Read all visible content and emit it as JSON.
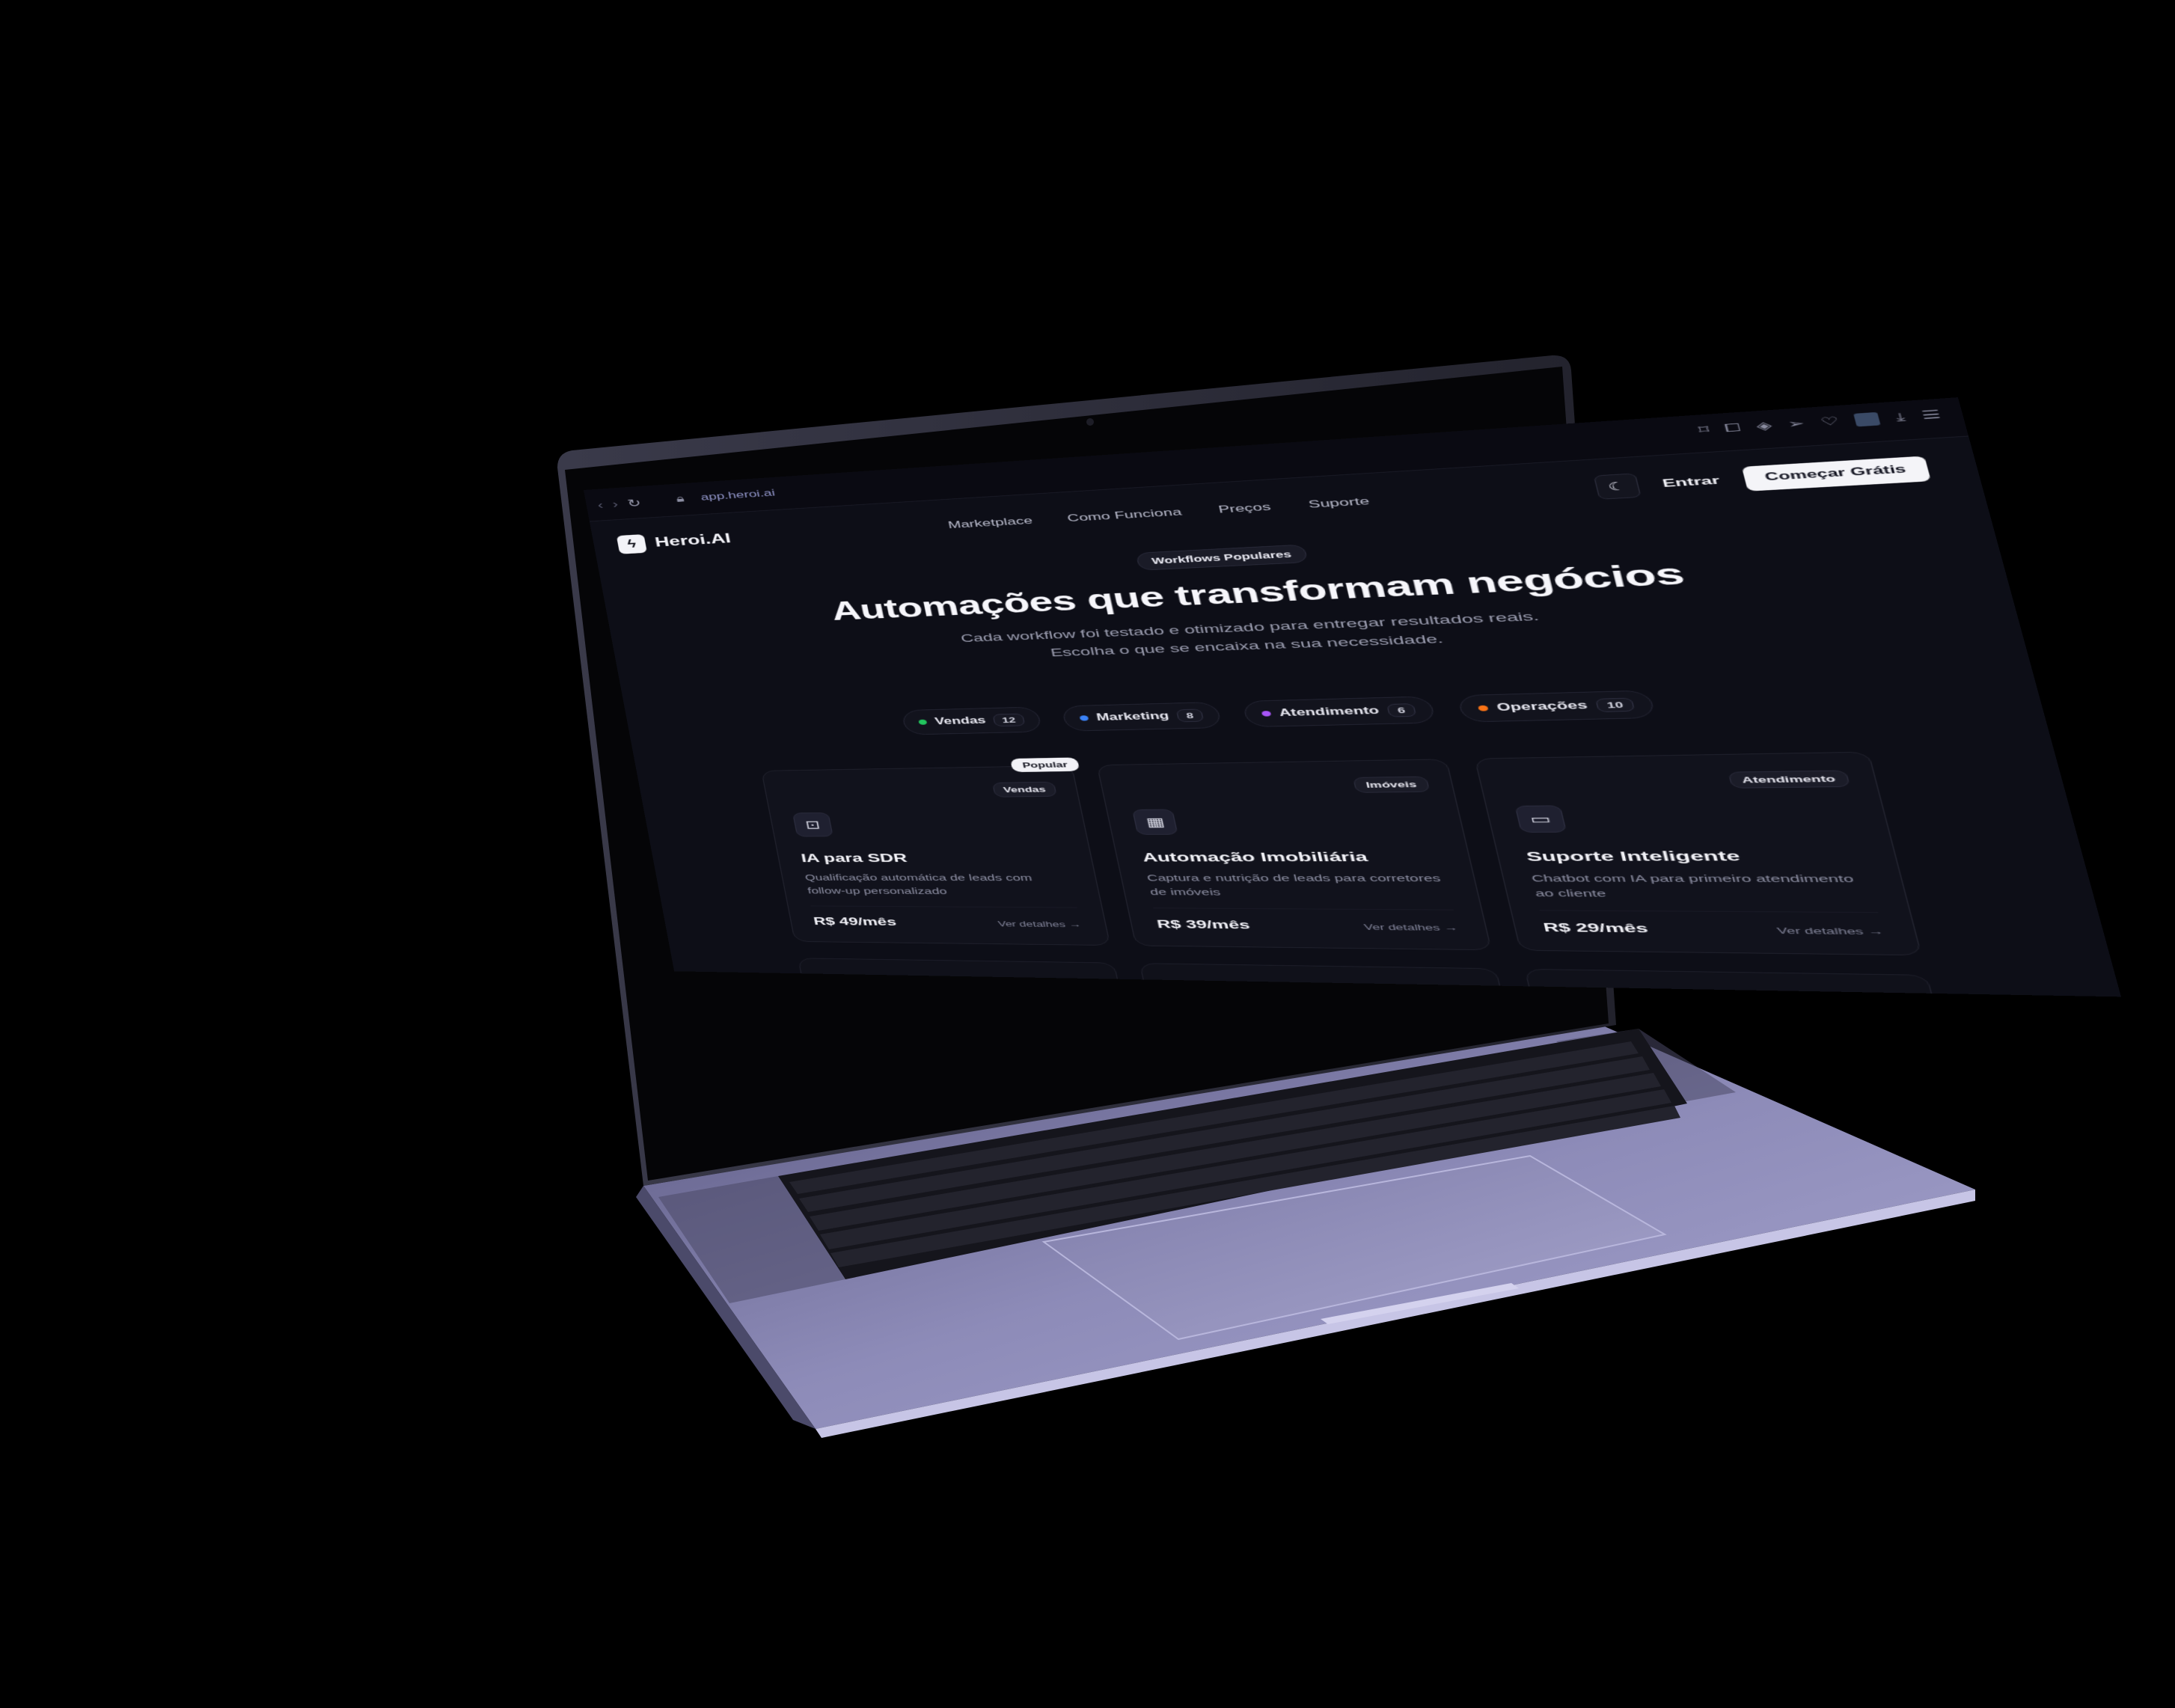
{
  "browser": {
    "url": "app.heroi.ai",
    "icons": [
      "back-icon",
      "forward-icon",
      "reload-icon",
      "lock-icon",
      "search-icon",
      "minimize-icon",
      "restore-icon",
      "close-icon",
      "bookmark-icon",
      "screenshot-icon",
      "shield-icon",
      "send-icon",
      "heart-icon",
      "download-icon",
      "menu-icon"
    ]
  },
  "header": {
    "brand": "Heroi.AI",
    "nav": [
      "Marketplace",
      "Como Funciona",
      "Preços",
      "Suporte"
    ],
    "login": "Entrar",
    "cta": "Começar Grátis"
  },
  "hero": {
    "badge": "Workflows Populares",
    "title": "Automações que transformam negócios",
    "subtitle": "Cada workflow foi testado e otimizado para entregar resultados reais. Escolha o que se encaixa na sua necessidade."
  },
  "categories": [
    {
      "label": "Vendas",
      "count": "12",
      "color": "#22c55e"
    },
    {
      "label": "Marketing",
      "count": "8",
      "color": "#3b82f6"
    },
    {
      "label": "Atendimento",
      "count": "6",
      "color": "#a855f7"
    },
    {
      "label": "Operações",
      "count": "10",
      "color": "#f97316"
    }
  ],
  "cards": [
    {
      "badge": "Vendas",
      "popular": "Popular",
      "icon": "robot-icon",
      "title": "IA para SDR",
      "desc": "Qualificação automática de leads com follow-up personalizado",
      "price": "R$ 49/mês",
      "link": "Ver detalhes →"
    },
    {
      "badge": "Imóveis",
      "icon": "building-icon",
      "title": "Automação Imobiliária",
      "desc": "Captura e nutrição de leads para corretores de imóveis",
      "price": "R$ 39/mês",
      "link": "Ver detalhes →"
    },
    {
      "badge": "Atendimento",
      "icon": "chat-icon",
      "title": "Suporte Inteligente",
      "desc": "Chatbot com IA para primeiro atendimento ao cliente",
      "price": "R$ 29/mês",
      "link": "Ver detalhes →"
    }
  ],
  "colors": {
    "background": "#0d0e17",
    "laptop_aluminum": "#8a88b4",
    "keyboard": "#15151c"
  }
}
